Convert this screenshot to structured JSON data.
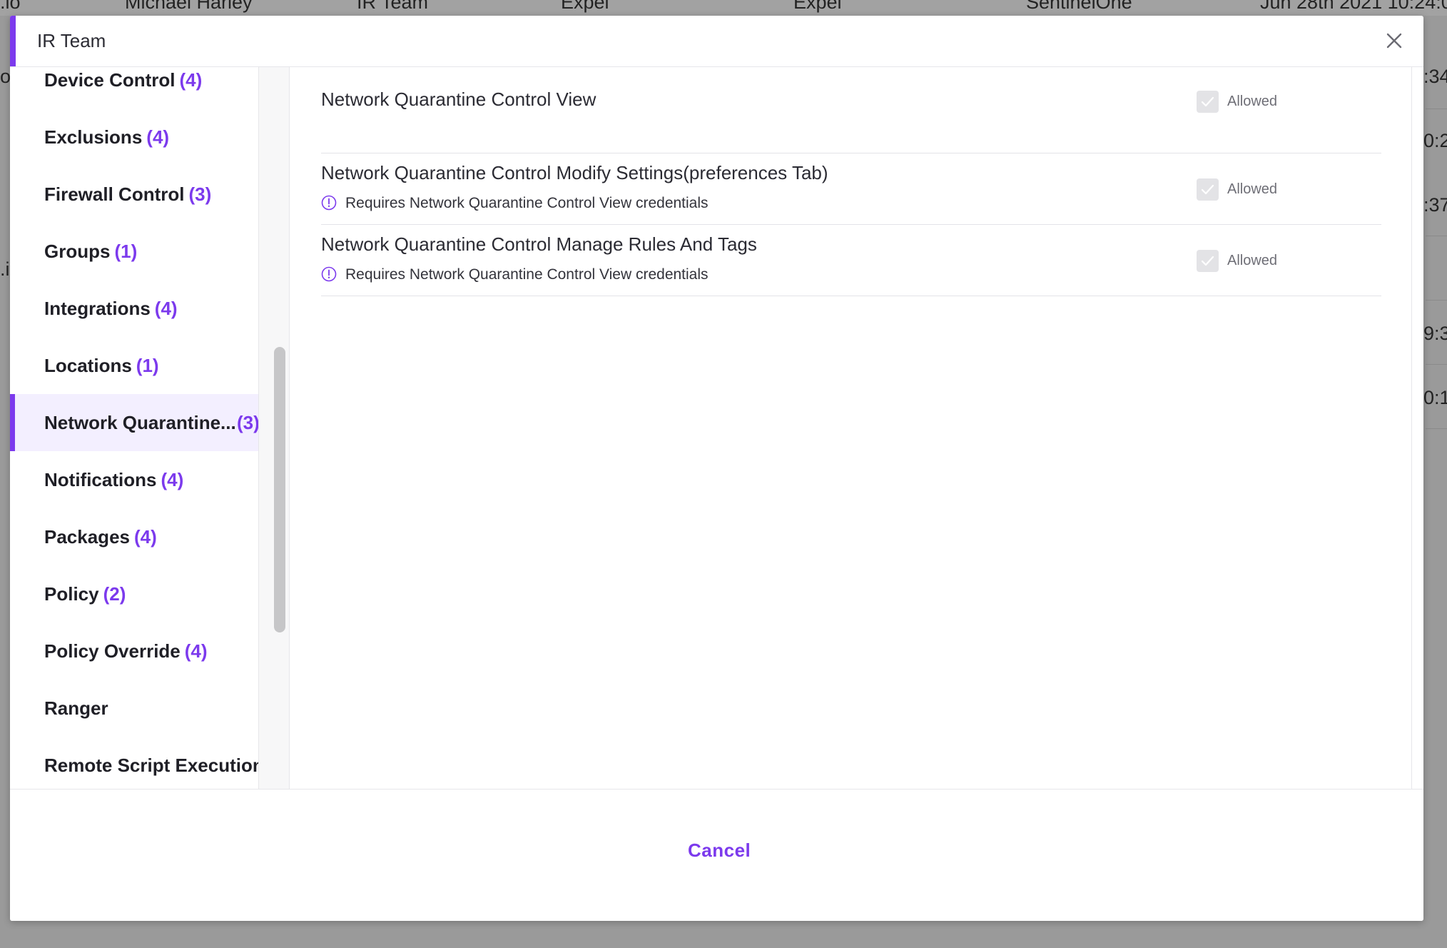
{
  "background": {
    "header_cells": [
      ".io",
      "Michael Harley",
      "IR Team",
      "Expel",
      "Expel",
      "SentinelOne",
      "Jun 28th 2021 10:24:0"
    ],
    "row_fragments": [
      "o",
      ":34",
      "0:2",
      ":37",
      ".i",
      "9:3",
      "0:1"
    ]
  },
  "modal": {
    "title": "IR Team",
    "close_label": "×",
    "accent_color": "#7c3aed"
  },
  "sidebar": {
    "items": [
      {
        "label": "Device Control",
        "count": "(4)"
      },
      {
        "label": "Exclusions",
        "count": "(4)"
      },
      {
        "label": "Firewall Control",
        "count": "(3)"
      },
      {
        "label": "Groups",
        "count": "(1)"
      },
      {
        "label": "Integrations",
        "count": "(4)"
      },
      {
        "label": "Locations",
        "count": "(1)"
      },
      {
        "label": "Network Quarantine...",
        "count": "(3)"
      },
      {
        "label": "Notifications",
        "count": "(4)"
      },
      {
        "label": "Packages",
        "count": "(4)"
      },
      {
        "label": "Policy",
        "count": "(2)"
      },
      {
        "label": "Policy Override",
        "count": "(4)"
      },
      {
        "label": "Ranger",
        "count": ""
      },
      {
        "label": "Remote Script Execution",
        "count": ""
      }
    ],
    "active_index": 6
  },
  "permissions": [
    {
      "title": "Network Quarantine Control View",
      "note": "",
      "status": "Allowed",
      "checked": true
    },
    {
      "title": "Network Quarantine Control Modify Settings(preferences Tab)",
      "note": "Requires Network Quarantine Control View credentials",
      "status": "Allowed",
      "checked": true
    },
    {
      "title": "Network Quarantine Control Manage Rules And Tags",
      "note": "Requires Network Quarantine Control View credentials",
      "status": "Allowed",
      "checked": true
    }
  ],
  "footer": {
    "cancel_label": "Cancel"
  }
}
